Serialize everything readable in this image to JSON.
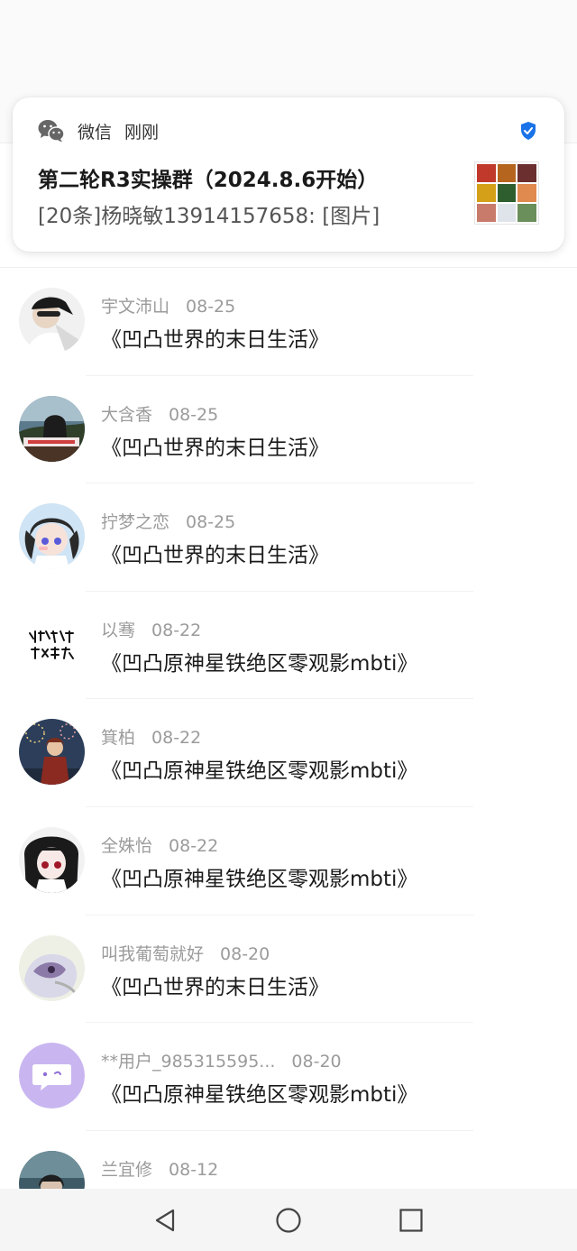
{
  "notification": {
    "app_name": "微信",
    "time": "刚刚",
    "title": "第二轮R3实操群（2024.8.6开始）",
    "body": "[20条]杨晓敏13914157658: [图片]",
    "app_icon": "wechat-icon",
    "verified_icon": "shield-check-icon",
    "thumbnail": "group-avatar-grid"
  },
  "list": {
    "items": [
      {
        "name": "宇文沛山",
        "date": "08-25",
        "title": "《凹凸世界的末日生活》",
        "avatar": "avatar-photo"
      },
      {
        "name": "大含香",
        "date": "08-25",
        "title": "《凹凸世界的末日生活》",
        "avatar": "avatar-photo"
      },
      {
        "name": "拧梦之恋",
        "date": "08-25",
        "title": "《凹凸世界的末日生活》",
        "avatar": "avatar-photo"
      },
      {
        "name": "以骞",
        "date": "08-22",
        "title": "《凹凸原神星铁绝区零观影mbti》",
        "avatar": "avatar-calligraphy"
      },
      {
        "name": "箕柏",
        "date": "08-22",
        "title": "《凹凸原神星铁绝区零观影mbti》",
        "avatar": "avatar-photo"
      },
      {
        "name": "全姝怡",
        "date": "08-22",
        "title": "《凹凸原神星铁绝区零观影mbti》",
        "avatar": "avatar-photo"
      },
      {
        "name": "叫我葡萄就好",
        "date": "08-20",
        "title": "《凹凸世界的末日生活》",
        "avatar": "avatar-photo"
      },
      {
        "name": "**用户_985315595...",
        "date": "08-20",
        "title": "《凹凸原神星铁绝区零观影mbti》",
        "avatar": "avatar-default-chat"
      },
      {
        "name": "兰宜修",
        "date": "08-12",
        "title": "",
        "avatar": "avatar-photo"
      }
    ]
  },
  "navbar": {
    "back": "back-triangle-icon",
    "home": "home-circle-icon",
    "recents": "recents-square-icon"
  },
  "colors": {
    "meta_gray": "#9b9b9b",
    "verified_blue": "#1a73e8",
    "default_avatar_purple": "#c9b6f0"
  }
}
